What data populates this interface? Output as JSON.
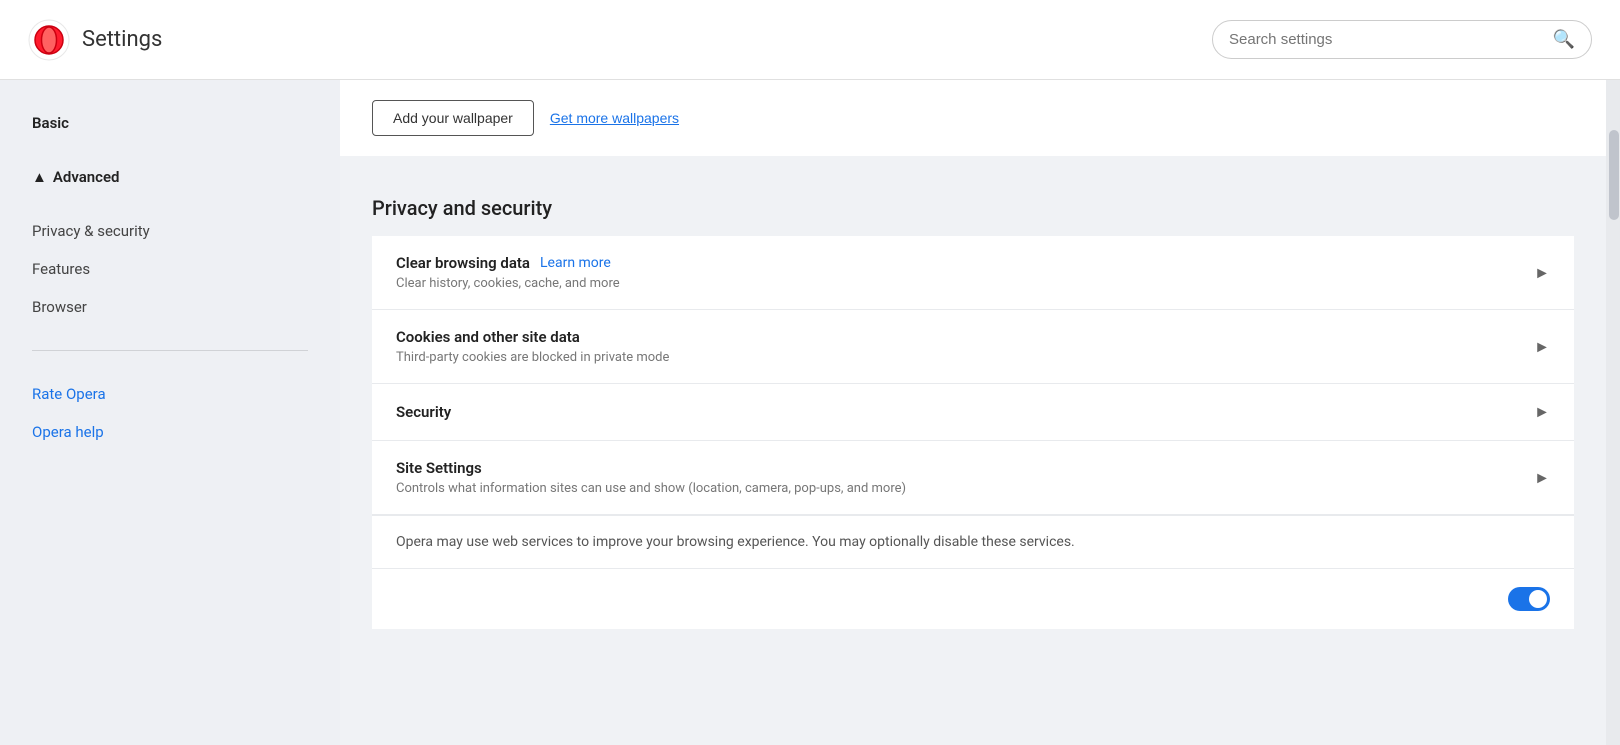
{
  "header": {
    "title": "Settings",
    "search_placeholder": "Search settings"
  },
  "sidebar": {
    "basic_label": "Basic",
    "advanced_label": "Advanced",
    "arrow_up": "▲",
    "items": [
      {
        "label": "Privacy & security",
        "type": "sub"
      },
      {
        "label": "Features",
        "type": "sub"
      },
      {
        "label": "Browser",
        "type": "sub"
      }
    ],
    "links": [
      {
        "label": "Rate Opera"
      },
      {
        "label": "Opera help"
      }
    ]
  },
  "content": {
    "wallpaper": {
      "add_button": "Add your wallpaper",
      "get_more_link": "Get more wallpapers"
    },
    "privacy_section": {
      "title": "Privacy and security",
      "rows": [
        {
          "title": "Clear browsing data",
          "learn_more": "Learn more",
          "description": "Clear history, cookies, cache, and more"
        },
        {
          "title": "Cookies and other site data",
          "learn_more": "",
          "description": "Third-party cookies are blocked in private mode"
        },
        {
          "title": "Security",
          "learn_more": "",
          "description": ""
        },
        {
          "title": "Site Settings",
          "learn_more": "",
          "description": "Controls what information sites can use and show (location, camera, pop-ups, and more)"
        }
      ],
      "info_text": "Opera may use web services to improve your browsing experience. You may optionally disable these services.",
      "partial_row_text": ""
    }
  }
}
